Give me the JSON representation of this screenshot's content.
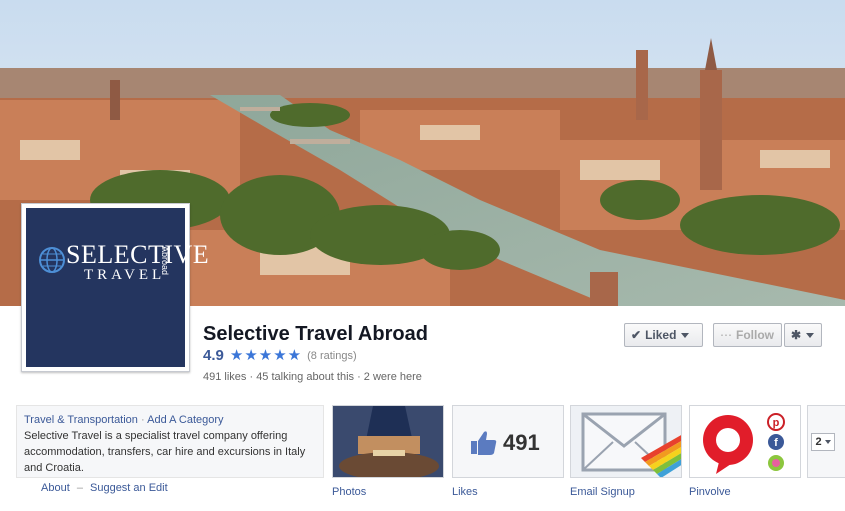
{
  "page": {
    "name": "Selective Travel Abroad",
    "rating_value": "4.9",
    "rating_count": "(8 ratings)",
    "stars": 5,
    "stats": "491 likes · 45 talking about this · 2 were here"
  },
  "logo": {
    "line1": "SELECTIVE",
    "line2": "TRAVEL",
    "vertical": "Abroad"
  },
  "actions": {
    "liked_label": "Liked",
    "follow_label": "Follow"
  },
  "about": {
    "category": "Travel & Transportation",
    "add_category": "Add A Category",
    "description": "Selective Travel is a specialist travel company offering accommodation, transfers, car hire and excursions in Italy and Croatia.",
    "about_link": "About",
    "suggest_link": "Suggest an Edit"
  },
  "apps": {
    "photos_label": "Photos",
    "likes_label": "Likes",
    "likes_count": "491",
    "email_label": "Email Signup",
    "pinvolve_label": "Pinvolve",
    "more_count": "2"
  },
  "colors": {
    "fb_blue": "#3b5998",
    "logo_bg": "#24355f",
    "star": "#3b76d8"
  }
}
